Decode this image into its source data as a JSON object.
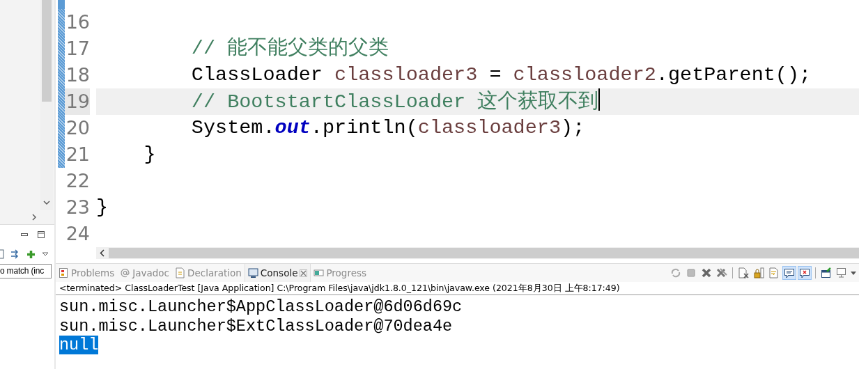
{
  "sidebar": {
    "filter_field": {
      "value": "o match (inc"
    }
  },
  "editor": {
    "lines": [
      {
        "number": "16",
        "changed": true,
        "current": false
      },
      {
        "number": "17",
        "changed": true,
        "current": false,
        "tokens": [
          {
            "text": "        // 能不能父类的父类",
            "kind": "comment"
          }
        ]
      },
      {
        "number": "18",
        "changed": true,
        "current": false,
        "tokens": [
          {
            "text": "        ClassLoader ",
            "kind": "plain"
          },
          {
            "text": "classloader3",
            "kind": "var"
          },
          {
            "text": " = ",
            "kind": "plain"
          },
          {
            "text": "classloader2",
            "kind": "var"
          },
          {
            "text": ".getParent();",
            "kind": "plain"
          }
        ]
      },
      {
        "number": "19",
        "changed": true,
        "current": true,
        "tokens": [
          {
            "text": "        // BootstartClassLoader 这个获取不到",
            "kind": "comment"
          }
        ]
      },
      {
        "number": "20",
        "changed": true,
        "current": false,
        "tokens": [
          {
            "text": "        System.",
            "kind": "plain"
          },
          {
            "text": "out",
            "kind": "field"
          },
          {
            "text": ".println(",
            "kind": "plain"
          },
          {
            "text": "classloader3",
            "kind": "var"
          },
          {
            "text": ");",
            "kind": "plain"
          }
        ]
      },
      {
        "number": "21",
        "changed": true,
        "current": false,
        "tokens": [
          {
            "text": "    }",
            "kind": "plain"
          }
        ]
      },
      {
        "number": "22",
        "changed": false,
        "current": false
      },
      {
        "number": "23",
        "changed": false,
        "current": false,
        "tokens": [
          {
            "text": "}",
            "kind": "plain"
          }
        ]
      },
      {
        "number": "24",
        "changed": false,
        "current": false
      }
    ]
  },
  "panel": {
    "tabs": [
      {
        "label": "Problems",
        "kind": "problems",
        "selected": false
      },
      {
        "label": "Javadoc",
        "kind": "javadoc",
        "selected": false
      },
      {
        "label": "Declaration",
        "kind": "declaration",
        "selected": false
      },
      {
        "label": "Console",
        "kind": "console",
        "selected": true
      },
      {
        "label": "Progress",
        "kind": "progress",
        "selected": false
      }
    ],
    "toolbar": [
      {
        "kind": "relaunch"
      },
      {
        "kind": "stop"
      },
      {
        "kind": "remove"
      },
      {
        "kind": "remove-all"
      },
      {
        "kind": "separator"
      },
      {
        "kind": "clear"
      },
      {
        "kind": "lock"
      },
      {
        "kind": "wrap"
      },
      {
        "kind": "show-out",
        "on": true
      },
      {
        "kind": "show-err",
        "on": true
      },
      {
        "kind": "separator"
      },
      {
        "kind": "pin"
      },
      {
        "kind": "display"
      }
    ],
    "console": {
      "header": "<terminated> ClassLoaderTest [Java Application] C:\\Program Files\\java\\jdk1.8.0_121\\bin\\javaw.exe (2021年8月30日 上午8:17:49)",
      "output": [
        {
          "text": "sun.misc.Launcher$AppClassLoader@6d06d69c",
          "selected": false
        },
        {
          "text": "sun.misc.Launcher$ExtClassLoader@70dea4e",
          "selected": false
        },
        {
          "text": "null",
          "selected": true
        }
      ]
    }
  }
}
